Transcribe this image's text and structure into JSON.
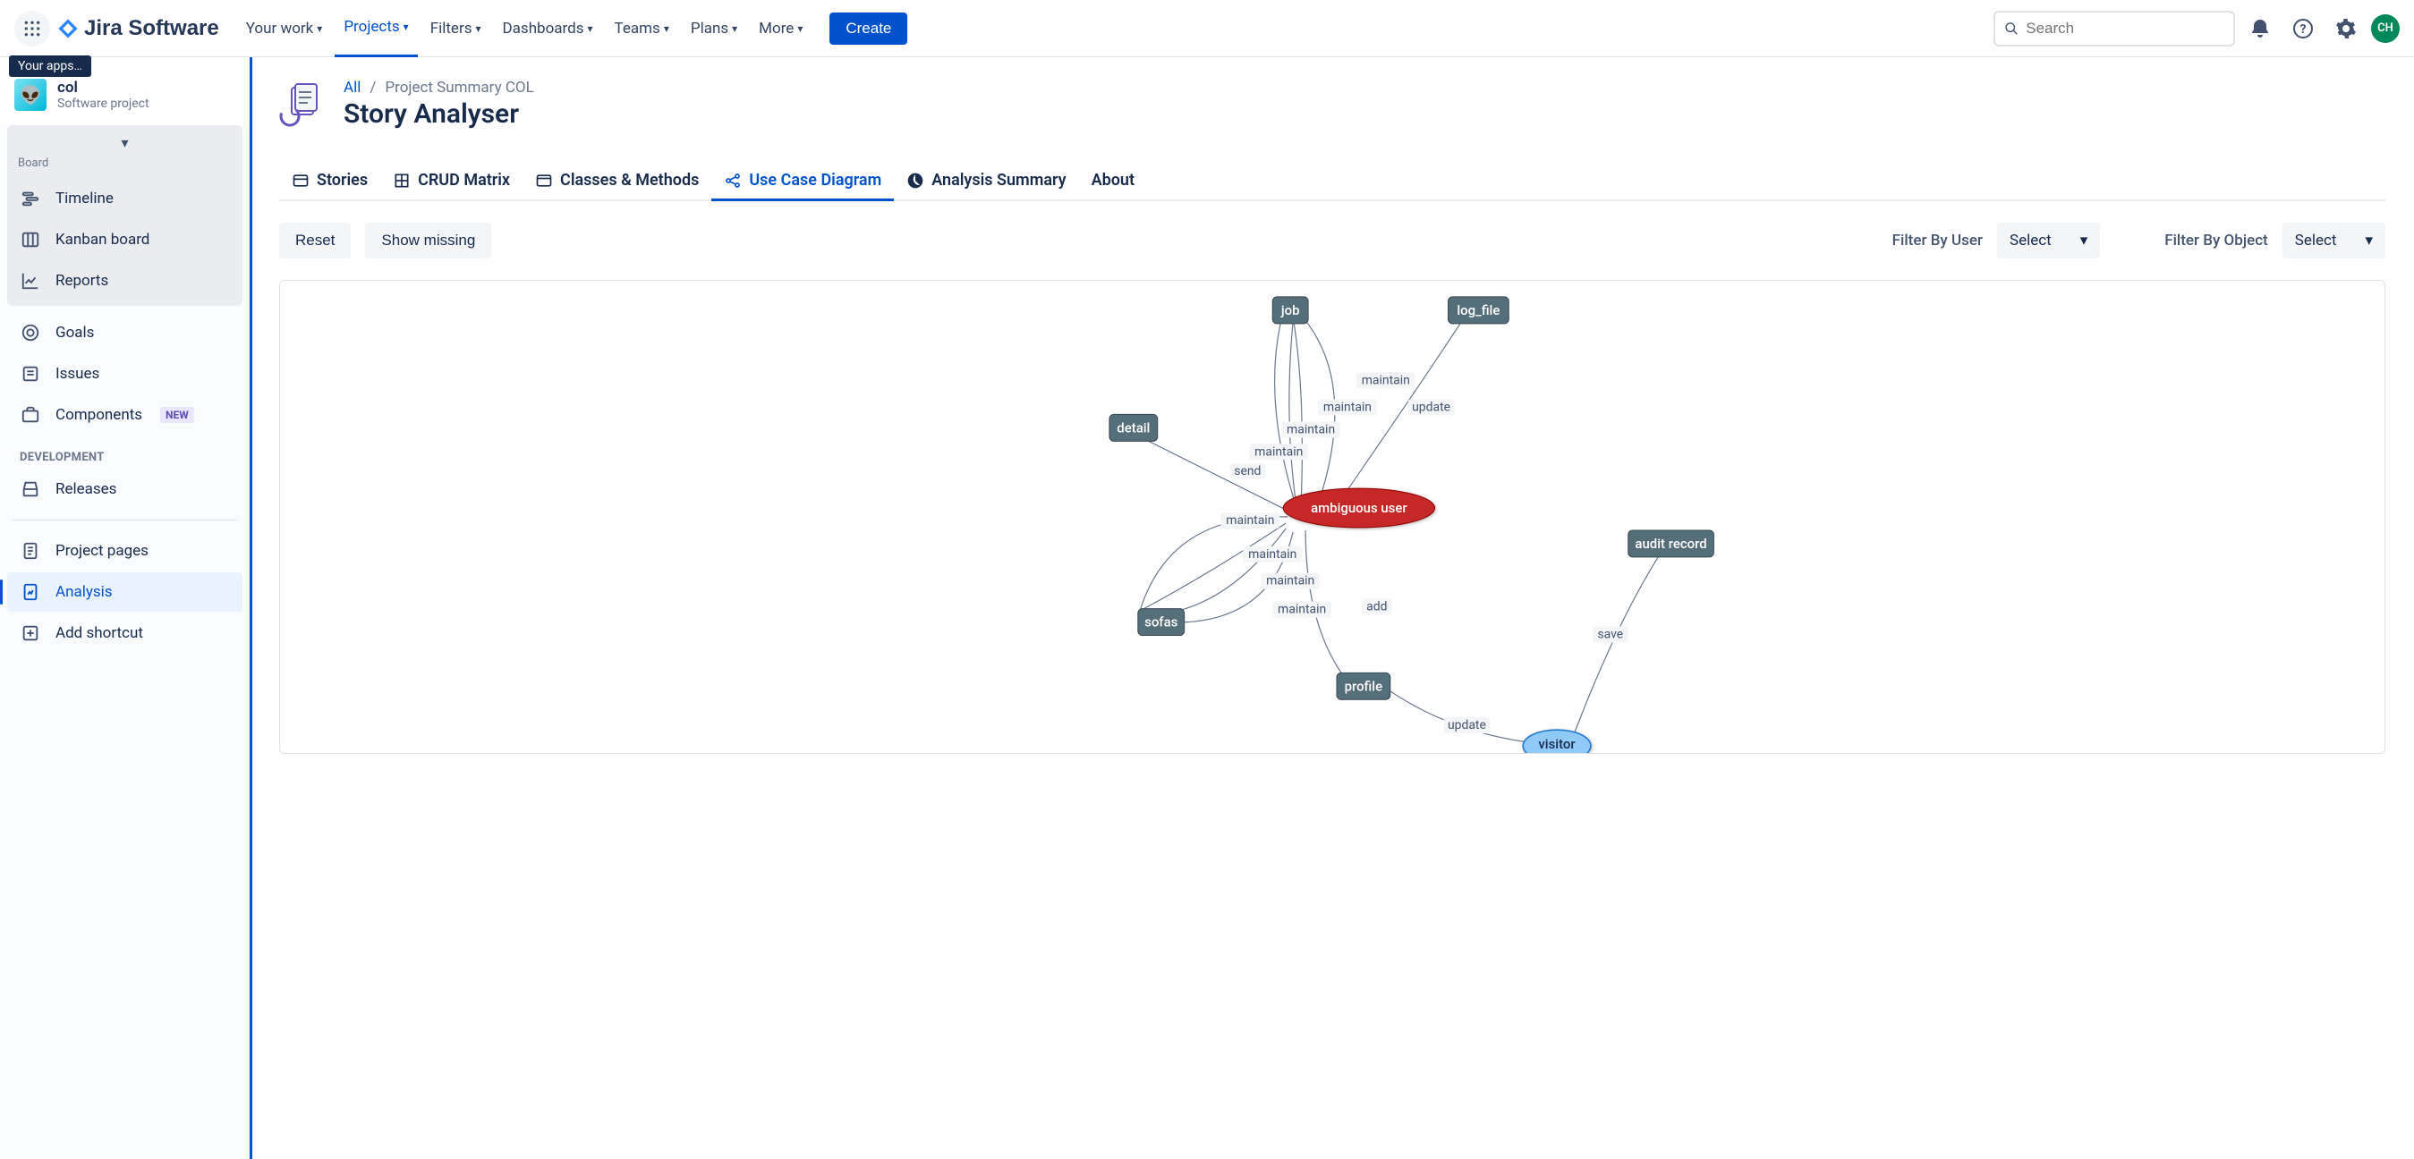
{
  "topnav": {
    "logo_text": "Jira Software",
    "items": [
      {
        "label": "Your work",
        "active": false
      },
      {
        "label": "Projects",
        "active": true
      },
      {
        "label": "Filters",
        "active": false
      },
      {
        "label": "Dashboards",
        "active": false
      },
      {
        "label": "Teams",
        "active": false
      },
      {
        "label": "Plans",
        "active": false
      },
      {
        "label": "More",
        "active": false
      }
    ],
    "create": "Create",
    "search_placeholder": "Search",
    "avatar_initials": "CH"
  },
  "tooltip": "Your apps…",
  "sidebar": {
    "project_name": "col",
    "project_type": "Software project",
    "board_label": "Board",
    "items": {
      "timeline": "Timeline",
      "kanban": "Kanban board",
      "reports": "Reports",
      "goals": "Goals",
      "issues": "Issues",
      "components": "Components",
      "components_badge": "NEW",
      "dev_section": "DEVELOPMENT",
      "releases": "Releases",
      "project_pages": "Project pages",
      "analysis": "Analysis",
      "add_shortcut": "Add shortcut"
    }
  },
  "page": {
    "breadcrumb_all": "All",
    "breadcrumb_current": "Project Summary COL",
    "title": "Story Analyser"
  },
  "tabs": [
    {
      "label": "Stories",
      "active": false
    },
    {
      "label": "CRUD Matrix",
      "active": false
    },
    {
      "label": "Classes & Methods",
      "active": false
    },
    {
      "label": "Use Case Diagram",
      "active": true
    },
    {
      "label": "Analysis Summary",
      "active": false
    },
    {
      "label": "About",
      "active": false
    }
  ],
  "toolbar": {
    "reset": "Reset",
    "show_missing": "Show missing",
    "filter_user_label": "Filter By User",
    "filter_object_label": "Filter By Object",
    "select_placeholder": "Select"
  },
  "diagram": {
    "nodes": {
      "job": "job",
      "log_file": "log_file",
      "detail": "detail",
      "ambiguous_user": "ambiguous user",
      "sofas": "sofas",
      "profile": "profile",
      "audit_record": "audit record",
      "visitor": "visitor"
    },
    "edges": {
      "maintain": "maintain",
      "update": "update",
      "send": "send",
      "add": "add",
      "save": "save"
    }
  }
}
